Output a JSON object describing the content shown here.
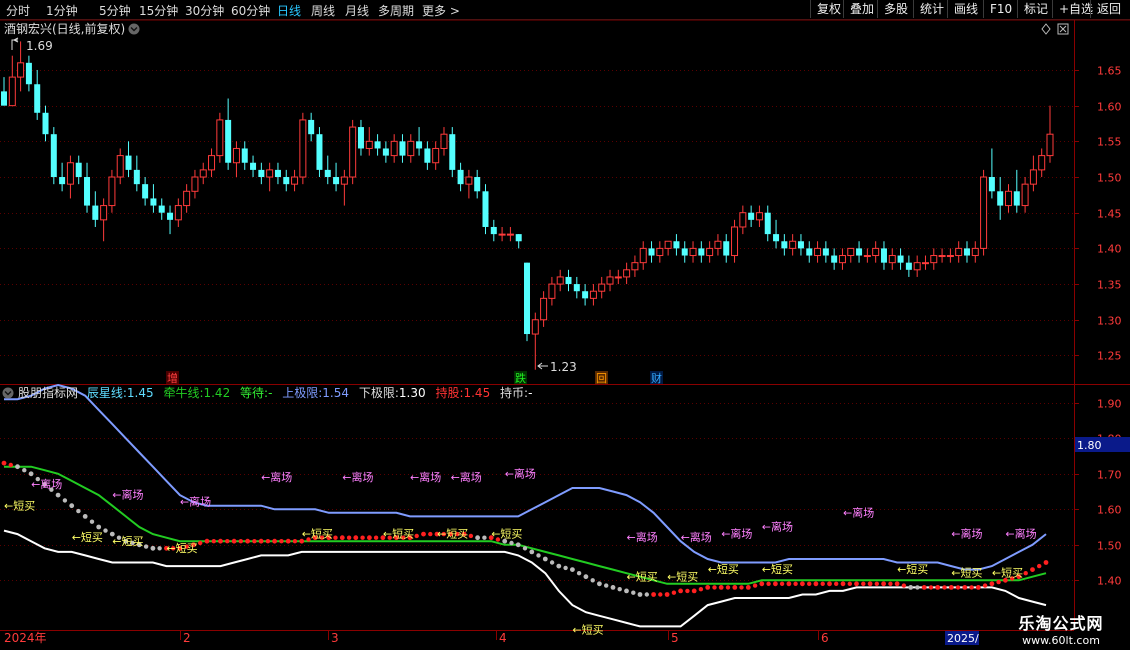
{
  "toolbar": {
    "periods": [
      "分时",
      "1分钟",
      "5分钟",
      "15分钟",
      "30分钟",
      "60分钟",
      "日线",
      "周线",
      "月线",
      "多周期",
      "更多 >"
    ],
    "active_period": "日线",
    "buttons": [
      "复权",
      "叠加",
      "多股",
      "统计",
      "画线",
      "F10",
      "标记",
      "+自选",
      "返回"
    ]
  },
  "main_panel": {
    "title": "酒钢宏兴(日线,前复权)",
    "high_label": "1.69",
    "low_label": "1.23",
    "y_ticks": [
      "1.65",
      "1.60",
      "1.55",
      "1.50",
      "1.45",
      "1.40",
      "1.35",
      "1.30",
      "1.25"
    ],
    "markers": [
      {
        "text": "增",
        "color": "#ff4040",
        "bg": "#4a0000"
      },
      {
        "text": "跌",
        "color": "#22ee22",
        "bg": "#003300"
      },
      {
        "text": "回",
        "color": "#ff9900",
        "bg": "#5a2a00"
      },
      {
        "text": "财",
        "color": "#33aaff",
        "bg": "#001a44"
      }
    ]
  },
  "indicator_panel": {
    "name": "股朋指标网",
    "items": [
      {
        "label": "辰星线:",
        "value": "1.45",
        "color": "#5fdcff"
      },
      {
        "label": "牵牛线:",
        "value": "1.42",
        "color": "#22cc22"
      },
      {
        "label": "等待:",
        "value": "-",
        "color": "#33ee33"
      },
      {
        "label": "上极限:",
        "value": "1.54",
        "color": "#7f9cff"
      },
      {
        "label": "下极限:",
        "value": "1.30",
        "color": "#ffffff"
      },
      {
        "label": "持股:",
        "value": "1.45",
        "color": "#ff3333"
      },
      {
        "label": "持币:",
        "value": "-",
        "color": "#ffffff"
      }
    ],
    "y_ticks": [
      "1.90",
      "1.80",
      "1.70",
      "1.60",
      "1.50",
      "1.40"
    ],
    "current_value": "1.80",
    "sell_label": "←离场",
    "buy_label": "←短买"
  },
  "x_axis": {
    "labels": [
      "2024年",
      "2",
      "3",
      "4",
      "5",
      "6",
      "2025/"
    ]
  },
  "watermark": {
    "line1": "乐淘公式网",
    "line2": "www.60lt.com"
  },
  "chart_data": {
    "type": "candlestick",
    "title": "酒钢宏兴(日线,前复权)",
    "ylim": [
      1.21,
      1.72
    ],
    "up_color": "#ff3b3b",
    "down_color": "#54ffff",
    "ohlc": [
      [
        1.62,
        1.64,
        1.6,
        1.6
      ],
      [
        1.6,
        1.67,
        1.6,
        1.64
      ],
      [
        1.64,
        1.69,
        1.62,
        1.66
      ],
      [
        1.66,
        1.67,
        1.62,
        1.63
      ],
      [
        1.63,
        1.65,
        1.58,
        1.59
      ],
      [
        1.59,
        1.6,
        1.55,
        1.56
      ],
      [
        1.56,
        1.57,
        1.49,
        1.5
      ],
      [
        1.5,
        1.52,
        1.48,
        1.49
      ],
      [
        1.49,
        1.53,
        1.47,
        1.52
      ],
      [
        1.52,
        1.53,
        1.49,
        1.5
      ],
      [
        1.5,
        1.52,
        1.45,
        1.46
      ],
      [
        1.46,
        1.48,
        1.43,
        1.44
      ],
      [
        1.44,
        1.47,
        1.41,
        1.46
      ],
      [
        1.46,
        1.51,
        1.45,
        1.5
      ],
      [
        1.5,
        1.54,
        1.49,
        1.53
      ],
      [
        1.53,
        1.55,
        1.5,
        1.51
      ],
      [
        1.51,
        1.53,
        1.48,
        1.49
      ],
      [
        1.49,
        1.5,
        1.46,
        1.47
      ],
      [
        1.47,
        1.49,
        1.45,
        1.46
      ],
      [
        1.46,
        1.47,
        1.44,
        1.45
      ],
      [
        1.45,
        1.46,
        1.42,
        1.44
      ],
      [
        1.44,
        1.47,
        1.43,
        1.46
      ],
      [
        1.46,
        1.49,
        1.45,
        1.48
      ],
      [
        1.48,
        1.51,
        1.47,
        1.5
      ],
      [
        1.5,
        1.52,
        1.49,
        1.51
      ],
      [
        1.51,
        1.54,
        1.5,
        1.53
      ],
      [
        1.53,
        1.59,
        1.52,
        1.58
      ],
      [
        1.58,
        1.61,
        1.51,
        1.52
      ],
      [
        1.52,
        1.55,
        1.5,
        1.54
      ],
      [
        1.54,
        1.55,
        1.51,
        1.52
      ],
      [
        1.52,
        1.53,
        1.5,
        1.51
      ],
      [
        1.51,
        1.52,
        1.49,
        1.5
      ],
      [
        1.5,
        1.52,
        1.48,
        1.51
      ],
      [
        1.51,
        1.52,
        1.49,
        1.5
      ],
      [
        1.5,
        1.51,
        1.48,
        1.49
      ],
      [
        1.49,
        1.51,
        1.48,
        1.5
      ],
      [
        1.5,
        1.59,
        1.49,
        1.58
      ],
      [
        1.58,
        1.59,
        1.55,
        1.56
      ],
      [
        1.56,
        1.57,
        1.5,
        1.51
      ],
      [
        1.51,
        1.53,
        1.49,
        1.5
      ],
      [
        1.5,
        1.52,
        1.48,
        1.49
      ],
      [
        1.49,
        1.51,
        1.46,
        1.5
      ],
      [
        1.5,
        1.58,
        1.49,
        1.57
      ],
      [
        1.57,
        1.58,
        1.53,
        1.54
      ],
      [
        1.54,
        1.57,
        1.53,
        1.55
      ],
      [
        1.55,
        1.56,
        1.53,
        1.54
      ],
      [
        1.54,
        1.55,
        1.52,
        1.53
      ],
      [
        1.53,
        1.56,
        1.52,
        1.55
      ],
      [
        1.55,
        1.56,
        1.52,
        1.53
      ],
      [
        1.53,
        1.56,
        1.52,
        1.55
      ],
      [
        1.55,
        1.57,
        1.53,
        1.54
      ],
      [
        1.54,
        1.55,
        1.51,
        1.52
      ],
      [
        1.52,
        1.55,
        1.51,
        1.54
      ],
      [
        1.54,
        1.57,
        1.53,
        1.56
      ],
      [
        1.56,
        1.57,
        1.5,
        1.51
      ],
      [
        1.51,
        1.52,
        1.48,
        1.49
      ],
      [
        1.49,
        1.51,
        1.47,
        1.5
      ],
      [
        1.5,
        1.51,
        1.47,
        1.48
      ],
      [
        1.48,
        1.49,
        1.42,
        1.43
      ],
      [
        1.43,
        1.44,
        1.41,
        1.42
      ],
      [
        1.42,
        1.43,
        1.41,
        1.42
      ],
      [
        1.42,
        1.43,
        1.41,
        1.42
      ],
      [
        1.42,
        1.42,
        1.4,
        1.41
      ],
      [
        1.38,
        1.38,
        1.27,
        1.28
      ],
      [
        1.28,
        1.31,
        1.23,
        1.3
      ],
      [
        1.3,
        1.34,
        1.29,
        1.33
      ],
      [
        1.33,
        1.36,
        1.32,
        1.35
      ],
      [
        1.35,
        1.37,
        1.34,
        1.36
      ],
      [
        1.36,
        1.37,
        1.34,
        1.35
      ],
      [
        1.35,
        1.36,
        1.33,
        1.34
      ],
      [
        1.34,
        1.35,
        1.32,
        1.33
      ],
      [
        1.33,
        1.35,
        1.32,
        1.34
      ],
      [
        1.34,
        1.36,
        1.33,
        1.35
      ],
      [
        1.35,
        1.37,
        1.34,
        1.36
      ],
      [
        1.36,
        1.37,
        1.35,
        1.36
      ],
      [
        1.36,
        1.38,
        1.35,
        1.37
      ],
      [
        1.37,
        1.39,
        1.36,
        1.38
      ],
      [
        1.38,
        1.41,
        1.37,
        1.4
      ],
      [
        1.4,
        1.41,
        1.38,
        1.39
      ],
      [
        1.39,
        1.41,
        1.38,
        1.4
      ],
      [
        1.4,
        1.41,
        1.39,
        1.41
      ],
      [
        1.41,
        1.42,
        1.39,
        1.4
      ],
      [
        1.4,
        1.41,
        1.38,
        1.39
      ],
      [
        1.39,
        1.41,
        1.38,
        1.4
      ],
      [
        1.4,
        1.41,
        1.38,
        1.39
      ],
      [
        1.39,
        1.41,
        1.38,
        1.4
      ],
      [
        1.4,
        1.42,
        1.39,
        1.41
      ],
      [
        1.41,
        1.42,
        1.38,
        1.39
      ],
      [
        1.39,
        1.44,
        1.38,
        1.43
      ],
      [
        1.43,
        1.46,
        1.42,
        1.45
      ],
      [
        1.45,
        1.46,
        1.43,
        1.44
      ],
      [
        1.44,
        1.46,
        1.43,
        1.45
      ],
      [
        1.45,
        1.46,
        1.41,
        1.42
      ],
      [
        1.42,
        1.44,
        1.4,
        1.41
      ],
      [
        1.41,
        1.42,
        1.39,
        1.4
      ],
      [
        1.4,
        1.42,
        1.39,
        1.41
      ],
      [
        1.41,
        1.42,
        1.39,
        1.4
      ],
      [
        1.4,
        1.41,
        1.38,
        1.39
      ],
      [
        1.39,
        1.41,
        1.38,
        1.4
      ],
      [
        1.4,
        1.41,
        1.38,
        1.39
      ],
      [
        1.39,
        1.4,
        1.37,
        1.38
      ],
      [
        1.38,
        1.4,
        1.37,
        1.39
      ],
      [
        1.39,
        1.4,
        1.38,
        1.4
      ],
      [
        1.4,
        1.41,
        1.38,
        1.39
      ],
      [
        1.39,
        1.4,
        1.38,
        1.39
      ],
      [
        1.39,
        1.41,
        1.38,
        1.4
      ],
      [
        1.4,
        1.41,
        1.37,
        1.38
      ],
      [
        1.38,
        1.4,
        1.37,
        1.39
      ],
      [
        1.39,
        1.4,
        1.37,
        1.38
      ],
      [
        1.38,
        1.39,
        1.36,
        1.37
      ],
      [
        1.37,
        1.39,
        1.36,
        1.38
      ],
      [
        1.38,
        1.39,
        1.37,
        1.38
      ],
      [
        1.38,
        1.4,
        1.37,
        1.39
      ],
      [
        1.39,
        1.4,
        1.38,
        1.39
      ],
      [
        1.39,
        1.4,
        1.38,
        1.39
      ],
      [
        1.39,
        1.41,
        1.38,
        1.4
      ],
      [
        1.4,
        1.41,
        1.38,
        1.39
      ],
      [
        1.39,
        1.41,
        1.38,
        1.4
      ],
      [
        1.4,
        1.51,
        1.39,
        1.5
      ],
      [
        1.5,
        1.54,
        1.47,
        1.48
      ],
      [
        1.48,
        1.5,
        1.44,
        1.46
      ],
      [
        1.46,
        1.49,
        1.45,
        1.48
      ],
      [
        1.48,
        1.51,
        1.45,
        1.46
      ],
      [
        1.46,
        1.5,
        1.45,
        1.49
      ],
      [
        1.49,
        1.53,
        1.48,
        1.51
      ],
      [
        1.51,
        1.54,
        1.5,
        1.53
      ],
      [
        1.53,
        1.6,
        1.52,
        1.56
      ]
    ],
    "indicator": {
      "ylim": [
        1.26,
        1.95
      ],
      "upper_limit": [
        1.91,
        1.91,
        1.92,
        1.94,
        1.95,
        1.94,
        1.92,
        1.88,
        1.84,
        1.8,
        1.76,
        1.72,
        1.68,
        1.64,
        1.62,
        1.61,
        1.61,
        1.61,
        1.61,
        1.61,
        1.6,
        1.6,
        1.6,
        1.6,
        1.59,
        1.59,
        1.59,
        1.59,
        1.59,
        1.59,
        1.58,
        1.58,
        1.58,
        1.58,
        1.58,
        1.58,
        1.58,
        1.58,
        1.58,
        1.6,
        1.62,
        1.64,
        1.66,
        1.66,
        1.66,
        1.65,
        1.64,
        1.62,
        1.59,
        1.55,
        1.51,
        1.48,
        1.46,
        1.45,
        1.45,
        1.45,
        1.45,
        1.45,
        1.46,
        1.46,
        1.46,
        1.46,
        1.46,
        1.46,
        1.46,
        1.46,
        1.45,
        1.45,
        1.45,
        1.45,
        1.44,
        1.43,
        1.43,
        1.44,
        1.46,
        1.48,
        1.5,
        1.53
      ],
      "lower_limit": [
        1.54,
        1.53,
        1.51,
        1.49,
        1.48,
        1.48,
        1.47,
        1.46,
        1.45,
        1.45,
        1.45,
        1.45,
        1.44,
        1.44,
        1.44,
        1.44,
        1.44,
        1.45,
        1.46,
        1.47,
        1.47,
        1.47,
        1.48,
        1.48,
        1.48,
        1.48,
        1.48,
        1.48,
        1.48,
        1.48,
        1.48,
        1.48,
        1.48,
        1.48,
        1.48,
        1.48,
        1.48,
        1.48,
        1.47,
        1.45,
        1.42,
        1.37,
        1.33,
        1.31,
        1.3,
        1.29,
        1.28,
        1.27,
        1.27,
        1.27,
        1.27,
        1.3,
        1.33,
        1.34,
        1.35,
        1.35,
        1.35,
        1.35,
        1.35,
        1.36,
        1.36,
        1.37,
        1.37,
        1.38,
        1.38,
        1.38,
        1.38,
        1.38,
        1.38,
        1.38,
        1.38,
        1.38,
        1.38,
        1.38,
        1.37,
        1.35,
        1.34,
        1.33
      ],
      "star_line": [
        1.73,
        1.72,
        1.7,
        1.67,
        1.64,
        1.61,
        1.58,
        1.55,
        1.53,
        1.51,
        1.5,
        1.49,
        1.49,
        1.49,
        1.5,
        1.51,
        1.51,
        1.51,
        1.51,
        1.51,
        1.51,
        1.51,
        1.51,
        1.52,
        1.52,
        1.52,
        1.52,
        1.52,
        1.52,
        1.52,
        1.52,
        1.53,
        1.53,
        1.53,
        1.53,
        1.52,
        1.52,
        1.51,
        1.5,
        1.48,
        1.46,
        1.44,
        1.43,
        1.41,
        1.39,
        1.38,
        1.37,
        1.36,
        1.36,
        1.36,
        1.37,
        1.37,
        1.38,
        1.38,
        1.38,
        1.38,
        1.39,
        1.39,
        1.39,
        1.39,
        1.39,
        1.39,
        1.39,
        1.39,
        1.39,
        1.39,
        1.39,
        1.38,
        1.38,
        1.38,
        1.38,
        1.38,
        1.38,
        1.39,
        1.4,
        1.41,
        1.43,
        1.45
      ],
      "ox_line": [
        1.72,
        1.72,
        1.72,
        1.71,
        1.7,
        1.68,
        1.66,
        1.64,
        1.61,
        1.58,
        1.55,
        1.53,
        1.52,
        1.51,
        1.51,
        1.51,
        1.51,
        1.51,
        1.51,
        1.51,
        1.51,
        1.51,
        1.51,
        1.51,
        1.51,
        1.51,
        1.51,
        1.51,
        1.51,
        1.51,
        1.51,
        1.51,
        1.51,
        1.51,
        1.51,
        1.51,
        1.51,
        1.5,
        1.5,
        1.49,
        1.48,
        1.47,
        1.46,
        1.45,
        1.44,
        1.43,
        1.42,
        1.41,
        1.4,
        1.39,
        1.39,
        1.39,
        1.39,
        1.39,
        1.39,
        1.39,
        1.4,
        1.4,
        1.4,
        1.4,
        1.4,
        1.4,
        1.4,
        1.4,
        1.4,
        1.4,
        1.4,
        1.4,
        1.4,
        1.4,
        1.4,
        1.4,
        1.4,
        1.4,
        1.4,
        1.4,
        1.41,
        1.42
      ]
    }
  }
}
